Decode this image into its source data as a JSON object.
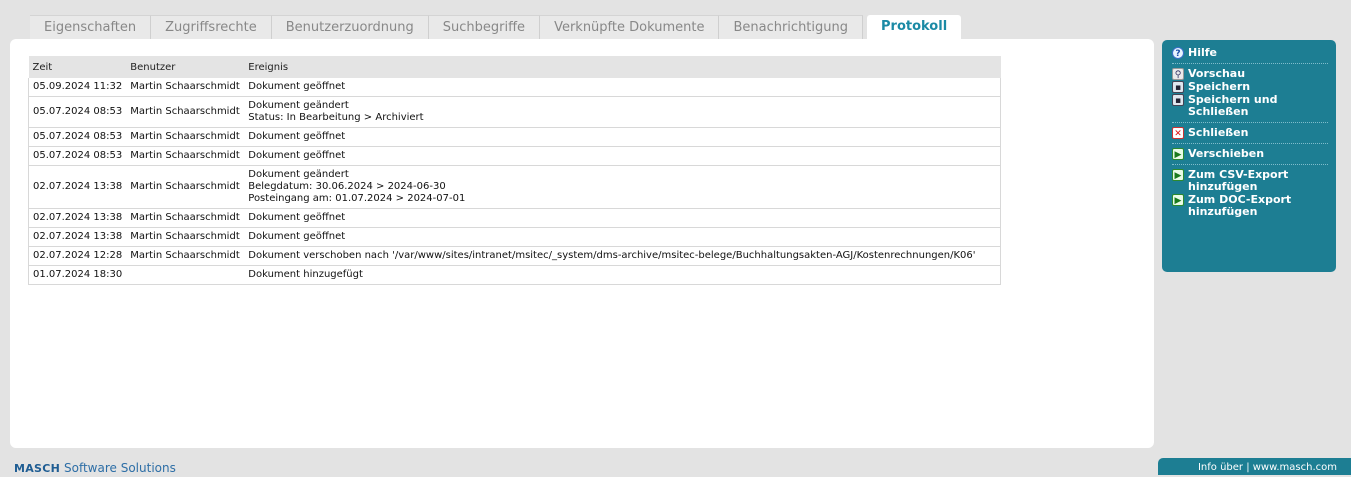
{
  "tabs": [
    {
      "label": "Eigenschaften"
    },
    {
      "label": "Zugriffsrechte"
    },
    {
      "label": "Benutzerzuordnung"
    },
    {
      "label": "Suchbegriffe"
    },
    {
      "label": "Verknüpfte Dokumente"
    },
    {
      "label": "Benachrichtigung"
    },
    {
      "label": "Protokoll",
      "active": true
    }
  ],
  "table": {
    "headers": {
      "time": "Zeit",
      "user": "Benutzer",
      "event": "Ereignis"
    },
    "rows": [
      {
        "time": "05.09.2024 11:32",
        "user": "Martin Schaarschmidt",
        "event": [
          "Dokument geöffnet"
        ]
      },
      {
        "time": "05.07.2024 08:53",
        "user": "Martin Schaarschmidt",
        "event": [
          "Dokument geändert",
          "Status: In Bearbeitung > Archiviert"
        ]
      },
      {
        "time": "05.07.2024 08:53",
        "user": "Martin Schaarschmidt",
        "event": [
          "Dokument geöffnet"
        ]
      },
      {
        "time": "05.07.2024 08:53",
        "user": "Martin Schaarschmidt",
        "event": [
          "Dokument geöffnet"
        ]
      },
      {
        "time": "02.07.2024 13:38",
        "user": "Martin Schaarschmidt",
        "event": [
          "Dokument geändert",
          "Belegdatum: 30.06.2024 > 2024-06-30",
          "Posteingang am: 01.07.2024 > 2024-07-01"
        ]
      },
      {
        "time": "02.07.2024 13:38",
        "user": "Martin Schaarschmidt",
        "event": [
          "Dokument geöffnet"
        ]
      },
      {
        "time": "02.07.2024 13:38",
        "user": "Martin Schaarschmidt",
        "event": [
          "Dokument geöffnet"
        ]
      },
      {
        "time": "02.07.2024 12:28",
        "user": "Martin Schaarschmidt",
        "event": [
          "Dokument verschoben nach '/var/www/sites/intranet/msitec/_system/dms-archive/msitec-belege/Buchhaltungsakten-AGJ/Kostenrechnungen/K06'"
        ]
      },
      {
        "time": "01.07.2024 18:30",
        "user": "",
        "event": [
          "Dokument hinzugefügt"
        ]
      }
    ]
  },
  "sidebar": {
    "help": "Hilfe",
    "preview": "Vorschau",
    "save": "Speichern",
    "save_close": "Speichern und Schließen",
    "close": "Schließen",
    "move": "Verschieben",
    "csv_export": "Zum CSV-Export hinzufügen",
    "doc_export": "Zum DOC-Export hinzufügen"
  },
  "footer": {
    "brand_bold": "MASCH",
    "brand_rest": "Software Solutions",
    "right": "Info über | www.masch.com"
  },
  "colors": {
    "accent": "#1d7e93",
    "active_tab": "#1b8aa5"
  }
}
